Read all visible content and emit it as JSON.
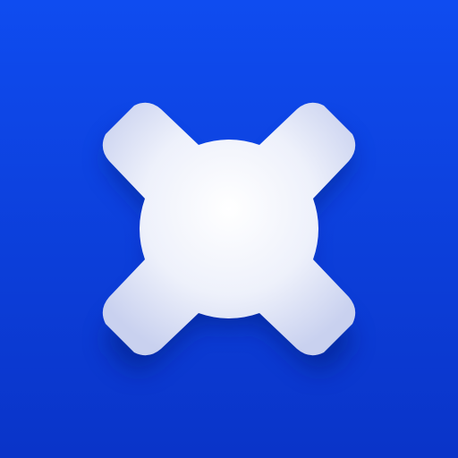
{
  "icon": {
    "name": "four-point-star-icon",
    "colors": {
      "background_top": "#0f4cf0",
      "background_bottom": "#0a34c8",
      "glyph_center": "#ffffff",
      "glyph_mid": "#eef1fb",
      "glyph_edge": "#c9d1ef",
      "shadow": "#061e78"
    }
  }
}
